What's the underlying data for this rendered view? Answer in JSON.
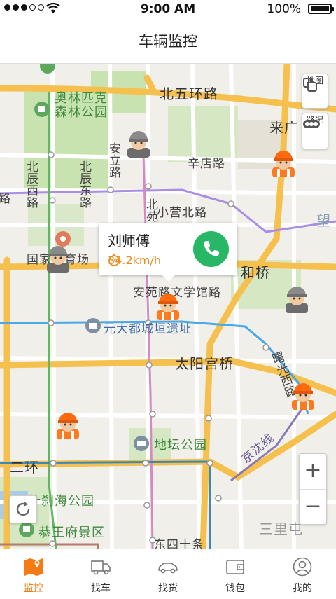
{
  "status_bar": {
    "time": "9:00 AM",
    "battery": "100%"
  },
  "navbar": {
    "title": "车辆监控"
  },
  "map": {
    "labels": {
      "olympic_park": "奥林匹克森林公园",
      "beiwuhuan": "北五环路",
      "laiguang": "来广",
      "anli_road": "安立路",
      "xindian_road": "辛店路",
      "beichen_west": "北辰西路",
      "beichen_east": "北辰东路",
      "beiyuan": "北苑",
      "xiaoying_north": "小营北路",
      "wang": "望",
      "guojia_tiyuchang": "国家体育场",
      "hexiao": "和桥",
      "anyuan_wenxueguan": "安苑路文学馆路",
      "yuandadu": "元大都城垣遗址",
      "taiyanggong": "太阳宫桥",
      "shuguang_west": "曙光西路",
      "ditan_park": "地坛公园",
      "erhuan": "二环",
      "shichahai": "什刹海公园",
      "gongwangfu": "恭王府景区",
      "sanlitun": "三里屯",
      "dongsishitiao": "东四十条",
      "jingshun": "京沈线",
      "lu_left": "路"
    },
    "controls": {
      "map_mode": "地图",
      "traffic": "路况",
      "zoom_in": "+",
      "zoom_out": "−"
    }
  },
  "popup": {
    "driver_name": "刘师傅",
    "speed": "34.2km/h"
  },
  "tabbar": {
    "tabs": [
      {
        "label": "监控",
        "icon": "map-icon",
        "active": true
      },
      {
        "label": "找车",
        "icon": "truck-icon",
        "active": false
      },
      {
        "label": "找货",
        "icon": "car-icon",
        "active": false
      },
      {
        "label": "钱包",
        "icon": "wallet-icon",
        "active": false
      },
      {
        "label": "我的",
        "icon": "user-icon",
        "active": false
      }
    ]
  },
  "colors": {
    "accent": "#f57c14",
    "call_green": "#27b766",
    "road_yellow": "#f6c04e",
    "park_green": "#c8e2b0"
  }
}
